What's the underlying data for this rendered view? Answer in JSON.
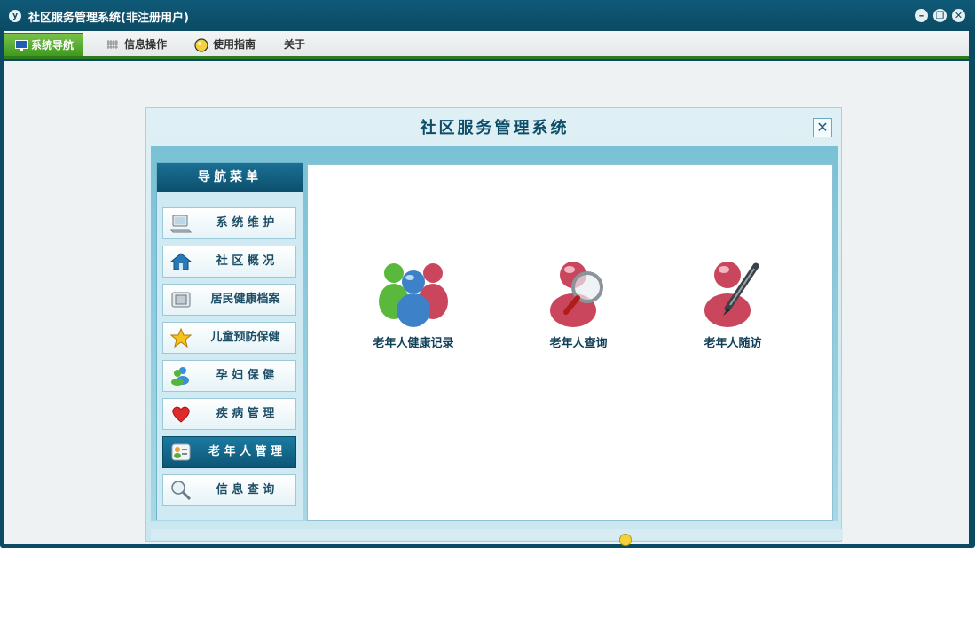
{
  "window": {
    "title": "社区服务管理系统(非注册用户)",
    "app_icon": "y"
  },
  "window_controls": {
    "minimize": "–",
    "restore": "❐",
    "close": "✕"
  },
  "menu": {
    "items": [
      {
        "label": "系统导航",
        "icon": "monitor-icon"
      },
      {
        "label": "信息操作",
        "icon": "grid-icon"
      },
      {
        "label": "使用指南",
        "icon": "bulb-icon"
      },
      {
        "label": "关于"
      }
    ]
  },
  "dialog": {
    "title": "社区服务管理系统",
    "close": "✕"
  },
  "nav": {
    "header": "导航菜单",
    "items": [
      {
        "label": "系 统 维 护",
        "icon": "computer-icon"
      },
      {
        "label": "社 区 概 况",
        "icon": "home-icon"
      },
      {
        "label": "居民健康档案",
        "icon": "folder-icon"
      },
      {
        "label": "儿童预防保健",
        "icon": "star-icon"
      },
      {
        "label": "孕 妇 保 健",
        "icon": "people-icon"
      },
      {
        "label": "疾 病 管 理",
        "icon": "heart-icon"
      },
      {
        "label": "老 年 人 管 理",
        "icon": "contacts-icon"
      },
      {
        "label": "信 息 查 询",
        "icon": "magnifier-icon"
      }
    ],
    "selected_index": 6
  },
  "tiles": [
    {
      "label": "老年人健康记录",
      "icon": "users-group-icon"
    },
    {
      "label": "老年人查询",
      "icon": "user-search-icon"
    },
    {
      "label": "老年人随访",
      "icon": "user-edit-icon"
    }
  ],
  "colors": {
    "accent": "#0b4a63",
    "menu_active": "#3f9a20",
    "nav_selected": "#0d5677"
  }
}
